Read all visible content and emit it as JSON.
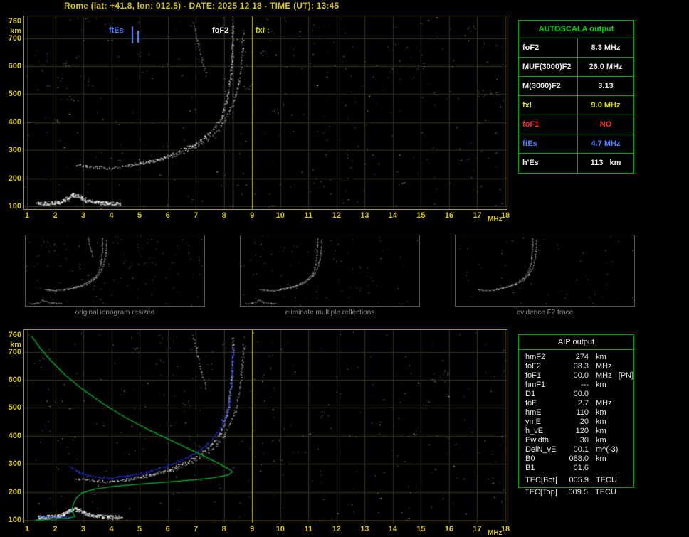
{
  "title": "Rome (lat: +41.8, lon: 012.5) - DATE: 2025 12 18 - TIME (UT): 13:45",
  "colors": {
    "axis": "#d6c41e",
    "grid": "#33331f",
    "white": "#e8e8e8",
    "yellow": "#d8d800",
    "red": "#ff2a2a",
    "blue": "#4d7dff",
    "profile_green": "#00b435",
    "trace_blue": "#2a3cff",
    "caption": "#8c8c8c",
    "table_border": "#00a400",
    "table_header_green": "#00d400"
  },
  "top_plot": {
    "y_ticks": [
      760,
      700,
      600,
      500,
      400,
      300,
      200,
      100
    ],
    "y_unit": "km",
    "x_ticks": [
      1,
      2,
      3,
      4,
      5,
      6,
      7,
      8,
      9,
      10,
      11,
      12,
      13,
      14,
      15,
      16,
      17,
      18
    ],
    "x_unit": "MHz",
    "marker_labels": {
      "ftEs": "ftEs",
      "foF2": "foF2",
      "fxI": "fxI :"
    }
  },
  "bottom_plot": {
    "y_ticks": [
      760,
      700,
      600,
      500,
      400,
      300,
      200,
      100
    ],
    "y_unit": "km",
    "x_ticks": [
      1,
      2,
      3,
      4,
      5,
      6,
      7,
      8,
      9,
      10,
      11,
      12,
      13,
      14,
      15,
      16,
      17,
      18
    ],
    "x_unit": "MHz"
  },
  "autoscala": {
    "header": "AUTOSCALA output",
    "rows": [
      {
        "label": "foF2",
        "value": "8.3 MHz",
        "color": "white"
      },
      {
        "label": "MUF(3000)F2",
        "value": "26.0 MHz",
        "color": "white"
      },
      {
        "label": "M(3000)F2",
        "value": "3.13",
        "color": "white"
      },
      {
        "label": "fxI",
        "value": "9.0 MHz",
        "color": "yellow"
      },
      {
        "label": "foF1",
        "value": "NO",
        "color": "red"
      },
      {
        "label": "ftEs",
        "value": "4.7 MHz",
        "color": "blue"
      },
      {
        "label": "h'Es",
        "value": "113   km",
        "color": "white"
      }
    ]
  },
  "aip": {
    "header": "AIP output",
    "rows": [
      {
        "label": "hmF2",
        "value": "274",
        "unit": "km"
      },
      {
        "label": "foF2",
        "value": "08.3",
        "unit": "MHz"
      },
      {
        "label": "foF1",
        "value": "00.0",
        "unit": "MHz   [PN]"
      },
      {
        "label": "hmF1",
        "value": "---",
        "unit": "km"
      },
      {
        "label": "D1",
        "value": "00.0",
        "unit": ""
      },
      {
        "label": "foE",
        "value": "2.7",
        "unit": "MHz"
      },
      {
        "label": "hmE",
        "value": "110",
        "unit": "km"
      },
      {
        "label": "ymE",
        "value": "20",
        "unit": "km"
      },
      {
        "label": "h_vE",
        "value": "120",
        "unit": "km"
      },
      {
        "label": "Ewidth",
        "value": "30",
        "unit": "km"
      },
      {
        "label": "DelN_vE",
        "value": "00.1",
        "unit": "m^(-3)"
      },
      {
        "label": "B0",
        "value": "088.0",
        "unit": "km"
      },
      {
        "label": "B1",
        "value": "01.6",
        "unit": ""
      }
    ],
    "tec_rows": [
      {
        "label": "TEC[Bot]",
        "value": "005.9",
        "unit": "TECU"
      },
      {
        "label": "TEC[Top]",
        "value": "009.5",
        "unit": "TECU"
      }
    ]
  },
  "thumbnails": [
    {
      "caption": "original ionogram resized"
    },
    {
      "caption": "eliminate multiple reflections"
    },
    {
      "caption": "evidence F2 trace"
    }
  ],
  "chart_data": {
    "type": "scatter",
    "x_label": "MHz",
    "y_label": "km",
    "x_range": [
      1,
      18
    ],
    "y_range": [
      100,
      760
    ],
    "markers": {
      "ftEs_MHz": 4.7,
      "foF2_MHz": 8.3,
      "fxI_MHz": 9.0,
      "hEs_km": 113,
      "hmF2_km": 274,
      "ftEs_ticks": [
        4.72,
        4.92
      ]
    },
    "traces": {
      "es_layer": [
        [
          1.35,
          112
        ],
        [
          1.7,
          112
        ],
        [
          2.1,
          115
        ],
        [
          2.35,
          125
        ],
        [
          2.6,
          142
        ],
        [
          2.85,
          136
        ],
        [
          3.1,
          122
        ],
        [
          3.5,
          115
        ],
        [
          3.9,
          112
        ],
        [
          4.3,
          111
        ]
      ],
      "f_ordinary": [
        [
          2.75,
          250
        ],
        [
          3.1,
          244
        ],
        [
          3.5,
          240
        ],
        [
          3.9,
          238
        ],
        [
          4.2,
          240
        ],
        [
          4.6,
          246
        ],
        [
          5.0,
          254
        ],
        [
          5.4,
          263
        ],
        [
          5.8,
          274
        ],
        [
          6.2,
          288
        ],
        [
          6.6,
          305
        ],
        [
          7.0,
          326
        ],
        [
          7.3,
          348
        ],
        [
          7.6,
          376
        ],
        [
          7.85,
          410
        ],
        [
          8.0,
          448
        ],
        [
          8.12,
          495
        ],
        [
          8.2,
          548
        ],
        [
          8.26,
          610
        ],
        [
          8.3,
          680
        ],
        [
          8.3,
          750
        ]
      ],
      "f_extraordinary": [
        [
          4.7,
          248
        ],
        [
          5.1,
          254
        ],
        [
          5.5,
          262
        ],
        [
          5.9,
          272
        ],
        [
          6.3,
          284
        ],
        [
          6.7,
          300
        ],
        [
          7.1,
          320
        ],
        [
          7.45,
          344
        ],
        [
          7.75,
          372
        ],
        [
          8.0,
          404
        ],
        [
          8.2,
          442
        ],
        [
          8.38,
          488
        ],
        [
          8.5,
          540
        ],
        [
          8.6,
          600
        ],
        [
          8.65,
          665
        ],
        [
          8.68,
          730
        ]
      ],
      "second_hop": [
        [
          6.9,
          758
        ],
        [
          7.05,
          690
        ],
        [
          7.2,
          625
        ],
        [
          7.35,
          570
        ]
      ],
      "restored_trace_blue": [
        [
          2.5,
          293
        ],
        [
          2.85,
          272
        ],
        [
          3.2,
          259
        ],
        [
          3.6,
          252
        ],
        [
          4.0,
          252
        ],
        [
          4.4,
          257
        ],
        [
          4.9,
          265
        ],
        [
          5.4,
          277
        ],
        [
          5.9,
          292
        ],
        [
          6.4,
          311
        ],
        [
          6.9,
          335
        ],
        [
          7.3,
          362
        ],
        [
          7.6,
          392
        ],
        [
          7.85,
          428
        ],
        [
          8.05,
          472
        ],
        [
          8.18,
          525
        ],
        [
          8.26,
          585
        ],
        [
          8.3,
          650
        ],
        [
          8.3,
          715
        ]
      ],
      "es_blue": [
        [
          1.4,
          113
        ],
        [
          1.8,
          111
        ],
        [
          2.2,
          111
        ],
        [
          2.5,
          113
        ]
      ],
      "density_profile_green": [
        [
          1.15,
          758
        ],
        [
          1.45,
          715
        ],
        [
          1.85,
          668
        ],
        [
          2.35,
          618
        ],
        [
          2.95,
          568
        ],
        [
          3.65,
          518
        ],
        [
          4.45,
          468
        ],
        [
          5.35,
          420
        ],
        [
          6.3,
          375
        ],
        [
          7.15,
          335
        ],
        [
          7.8,
          302
        ],
        [
          8.2,
          280
        ],
        [
          8.3,
          272
        ],
        [
          8.15,
          260
        ],
        [
          7.6,
          250
        ],
        [
          6.8,
          242
        ],
        [
          5.9,
          235
        ],
        [
          5.0,
          228
        ],
        [
          4.1,
          220
        ],
        [
          3.4,
          210
        ],
        [
          2.95,
          196
        ],
        [
          2.75,
          178
        ],
        [
          2.65,
          158
        ],
        [
          2.6,
          138
        ],
        [
          2.65,
          122
        ],
        [
          2.7,
          112
        ],
        [
          2.45,
          106
        ],
        [
          1.9,
          102
        ],
        [
          1.3,
          100
        ]
      ]
    }
  }
}
